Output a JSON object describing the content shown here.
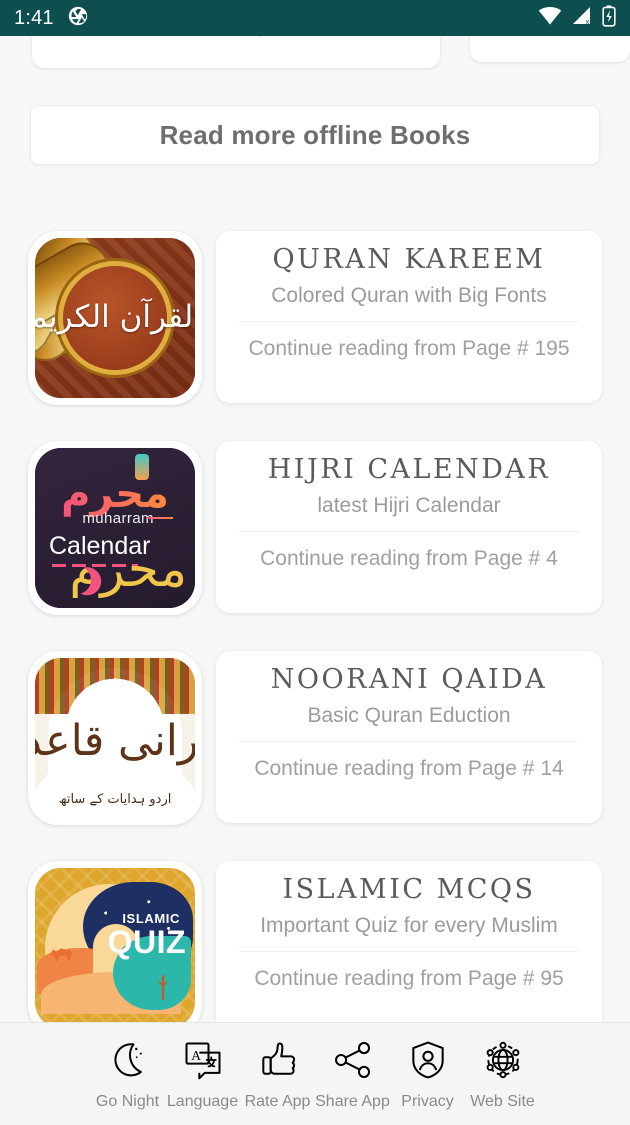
{
  "status_bar": {
    "time": "1:41",
    "icons": {
      "screenshot": "aperture-icon",
      "wifi": "wifi-icon",
      "cellular": "cellular-no-signal-icon",
      "battery": "battery-charging-icon"
    },
    "background_color": "#0d4f4f"
  },
  "header": {
    "read_more_label": "Read more offline Books"
  },
  "books": [
    {
      "title": "QURAN  KAREEM",
      "subtitle": "Colored Quran with Big Fonts",
      "continue": "Continue reading from Page # 195",
      "icon_name": "quran-kareem-icon",
      "icon_calligraphy": "القرآن الكريم",
      "icon_color": "#8c3a1c"
    },
    {
      "title": "HIJRI  CALENDAR",
      "subtitle": "latest Hijri Calendar",
      "continue": "Continue reading from Page # 4",
      "icon_name": "hijri-calendar-icon",
      "icon_arabic": "محرم",
      "icon_muharram": "muharram",
      "icon_calendar_word": "Calendar",
      "icon_gold_calligraphy": "محرم",
      "icon_color": "#2b2033"
    },
    {
      "title": "NOORANI  QAIDA",
      "subtitle": "Basic Quran Eduction",
      "continue": "Continue reading from Page # 14",
      "icon_name": "noorani-qaida-icon",
      "icon_calligraphy": "نورانی قاعدہ",
      "icon_urdu_sub": "اردو ہدایات کے ساتھ",
      "icon_color": "#fdfcfa"
    },
    {
      "title": "ISLAMIC  MCQS",
      "subtitle": "Important Quiz for every Muslim",
      "continue": "Continue reading from Page # 95",
      "icon_name": "islamic-quiz-icon",
      "icon_label_small": "ISLAMIC",
      "icon_label_big": "QUIZ",
      "icon_color": "#e0a52c"
    }
  ],
  "bottom_nav": [
    {
      "label": "Go Night",
      "icon": "moon-icon"
    },
    {
      "label": "Language",
      "icon": "translate-icon"
    },
    {
      "label": "Rate App",
      "icon": "thumbs-up-icon"
    },
    {
      "label": "Share App",
      "icon": "share-nodes-icon"
    },
    {
      "label": "Privacy",
      "icon": "shield-person-icon"
    },
    {
      "label": "Web Site",
      "icon": "globe-network-icon"
    }
  ]
}
